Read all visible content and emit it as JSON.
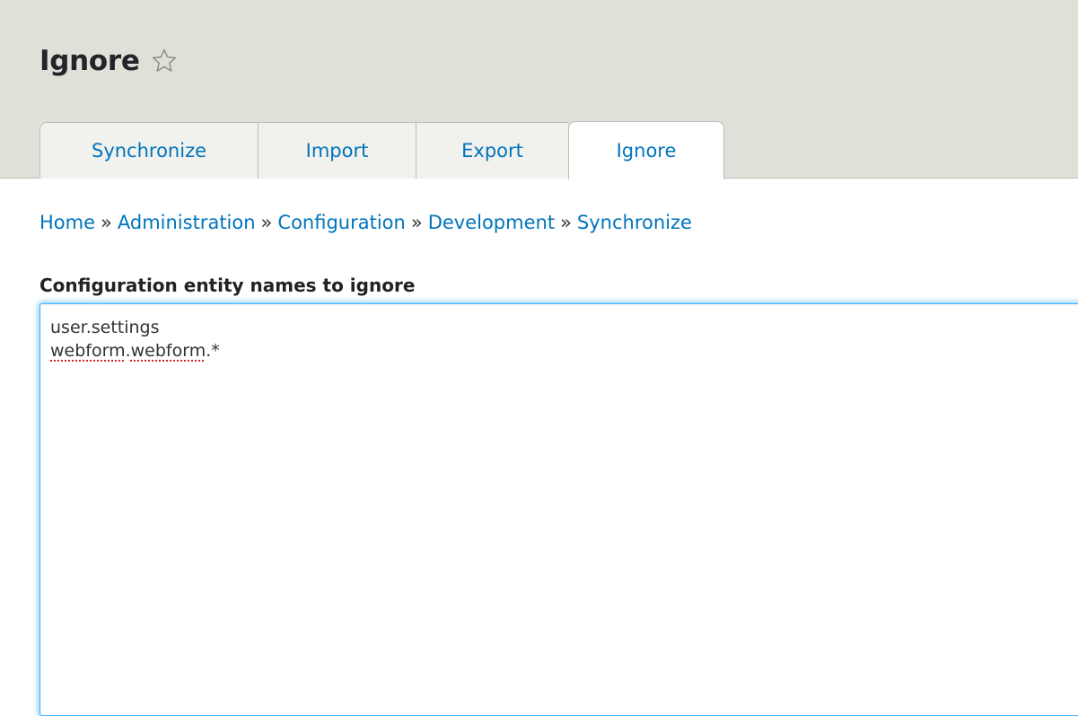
{
  "page": {
    "title": "Ignore"
  },
  "tabs": [
    {
      "label": "Synchronize"
    },
    {
      "label": "Import"
    },
    {
      "label": "Export"
    },
    {
      "label": "Ignore"
    }
  ],
  "breadcrumb": {
    "items": [
      "Home",
      "Administration",
      "Configuration",
      "Development",
      "Synchronize"
    ],
    "separator": "»"
  },
  "form": {
    "label": "Configuration entity names to ignore",
    "lines": [
      {
        "parts": [
          {
            "text": "user.settings"
          }
        ]
      },
      {
        "parts": [
          {
            "text": "webform",
            "misspelled": true
          },
          {
            "text": "."
          },
          {
            "text": "webform",
            "misspelled": true
          },
          {
            "text": ".*"
          }
        ]
      }
    ]
  },
  "icons": {
    "shortcut": "star-outline-icon"
  },
  "colors": {
    "header_bg": "#e0e0d8",
    "link": "#0074bd",
    "focus": "#40b6ff"
  }
}
